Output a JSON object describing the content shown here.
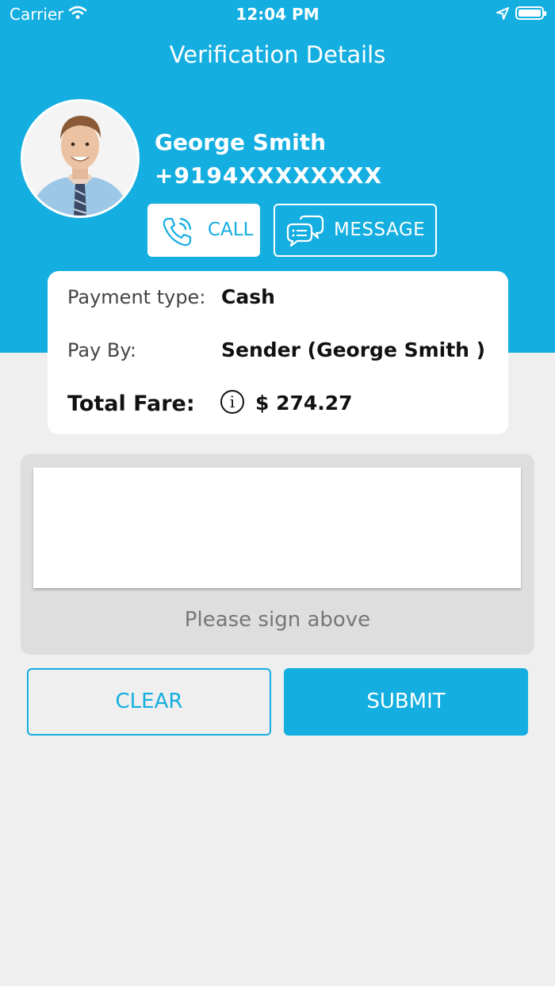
{
  "status_bar": {
    "carrier": "Carrier",
    "time": "12:04 PM",
    "icons": [
      "wifi-icon",
      "location-arrow-icon",
      "battery-icon"
    ]
  },
  "header": {
    "title": "Verification Details",
    "background_color": "#14aee0"
  },
  "user": {
    "name": "George Smith",
    "phone": "+9194XXXXXXXX",
    "avatar_icon": "profile-photo"
  },
  "actions": {
    "call_label": "CALL",
    "call_icon": "phone-icon",
    "message_label": "MESSAGE",
    "message_icon": "chat-bubbles-icon"
  },
  "payment": {
    "type_label": "Payment type:",
    "type_value": "Cash",
    "pay_by_label": "Pay By:",
    "pay_by_value": "Sender (George Smith )",
    "total_label": "Total Fare:",
    "total_value": "$ 274.27",
    "info_icon": "info-icon",
    "info_glyph": "i"
  },
  "signature": {
    "hint": "Please sign above"
  },
  "buttons": {
    "clear_label": "CLEAR",
    "submit_label": "SUBMIT",
    "accent_color": "#14aee0"
  }
}
